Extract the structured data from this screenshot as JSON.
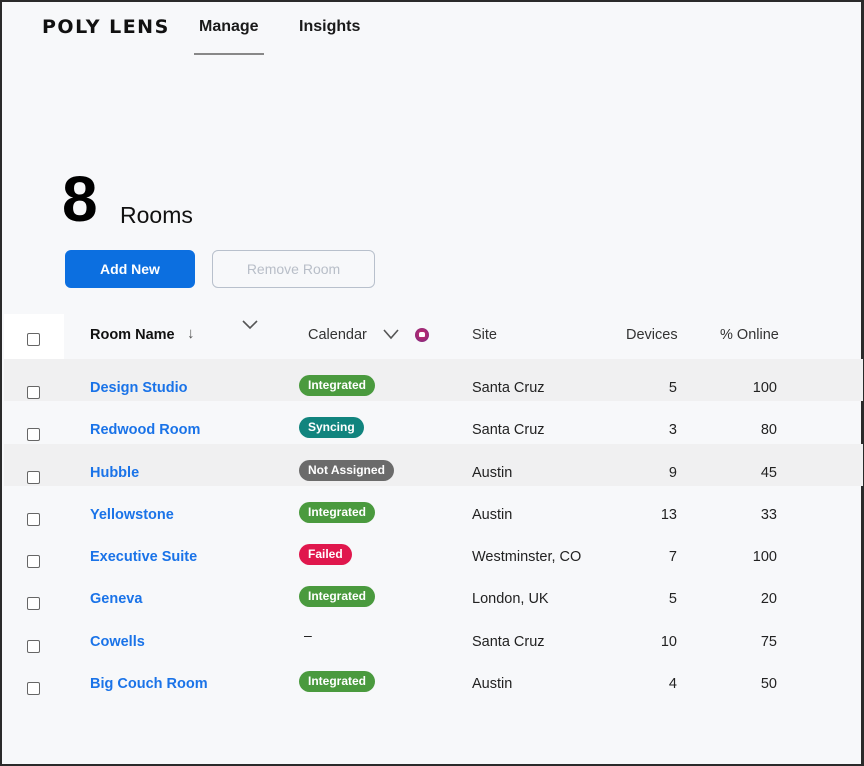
{
  "app": {
    "logo": "POLY LENS",
    "tabs": [
      {
        "label": "Manage",
        "active": true
      },
      {
        "label": "Insights",
        "active": false
      }
    ]
  },
  "summary": {
    "count": "8",
    "label": "Rooms"
  },
  "toolbar": {
    "add_label": "Add New",
    "remove_label": "Remove Room"
  },
  "colors": {
    "accent": "#0c6fe0",
    "link": "#1a73e8",
    "integrated": "#4a9a3e",
    "syncing": "#11847e",
    "not_assigned": "#6b6b6b",
    "failed": "#e0174d"
  },
  "table": {
    "headers": {
      "room_name": "Room Name",
      "calendar": "Calendar",
      "site": "Site",
      "devices": "Devices",
      "online": "% Online"
    },
    "sort_icon": "arrow-down-icon",
    "rows": [
      {
        "name": "Design Studio",
        "calendar": "Integrated",
        "calendar_status": "integrated",
        "site": "Santa Cruz",
        "devices": "5",
        "online": "100"
      },
      {
        "name": "Redwood Room",
        "calendar": "Syncing",
        "calendar_status": "syncing",
        "site": "Santa Cruz",
        "devices": "3",
        "online": "80"
      },
      {
        "name": "Hubble",
        "calendar": "Not Assigned",
        "calendar_status": "not_assigned",
        "site": "Austin",
        "devices": "9",
        "online": "45"
      },
      {
        "name": "Yellowstone",
        "calendar": "Integrated",
        "calendar_status": "integrated",
        "site": "Austin",
        "devices": "13",
        "online": "33"
      },
      {
        "name": "Executive Suite",
        "calendar": "Failed",
        "calendar_status": "failed",
        "site": "Westminster, CO",
        "devices": "7",
        "online": "100"
      },
      {
        "name": "Geneva",
        "calendar": "Integrated",
        "calendar_status": "integrated",
        "site": "London, UK",
        "devices": "5",
        "online": "20"
      },
      {
        "name": "Cowells",
        "calendar": "–",
        "calendar_status": "none",
        "site": "Santa Cruz",
        "devices": "10",
        "online": "75"
      },
      {
        "name": "Big Couch Room",
        "calendar": "Integrated",
        "calendar_status": "integrated",
        "site": "Austin",
        "devices": "4",
        "online": "50"
      }
    ]
  }
}
